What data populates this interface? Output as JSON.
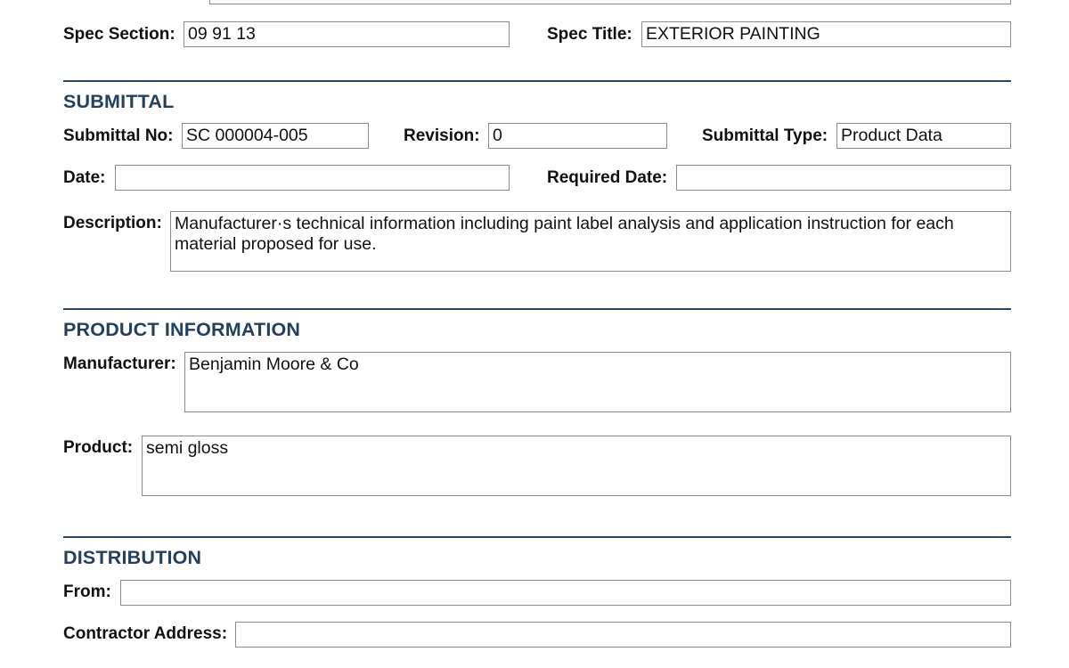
{
  "spec": {
    "section_label": "Spec Section:",
    "section_value": "09 91 13",
    "title_label": "Spec Title:",
    "title_value": "EXTERIOR PAINTING"
  },
  "submittal": {
    "heading": "SUBMITTAL",
    "no_label": "Submittal No:",
    "no_value": "SC 000004-005",
    "revision_label": "Revision:",
    "revision_value": "0",
    "type_label": "Submittal Type:",
    "type_value": "Product Data",
    "date_label": "Date:",
    "date_value": "",
    "required_date_label": "Required Date:",
    "required_date_value": "",
    "description_label": "Description:",
    "description_value": "Manufacturer·s technical information including paint label analysis and application instruction for each material proposed for use."
  },
  "product": {
    "heading": "PRODUCT INFORMATION",
    "manufacturer_label": "Manufacturer:",
    "manufacturer_value": "Benjamin Moore & Co",
    "product_label": "Product:",
    "product_value": "semi gloss"
  },
  "distribution": {
    "heading": "DISTRIBUTION",
    "from_label": "From:",
    "from_value": "",
    "contractor_address_label": "Contractor Address:",
    "contractor_address_value": ""
  }
}
